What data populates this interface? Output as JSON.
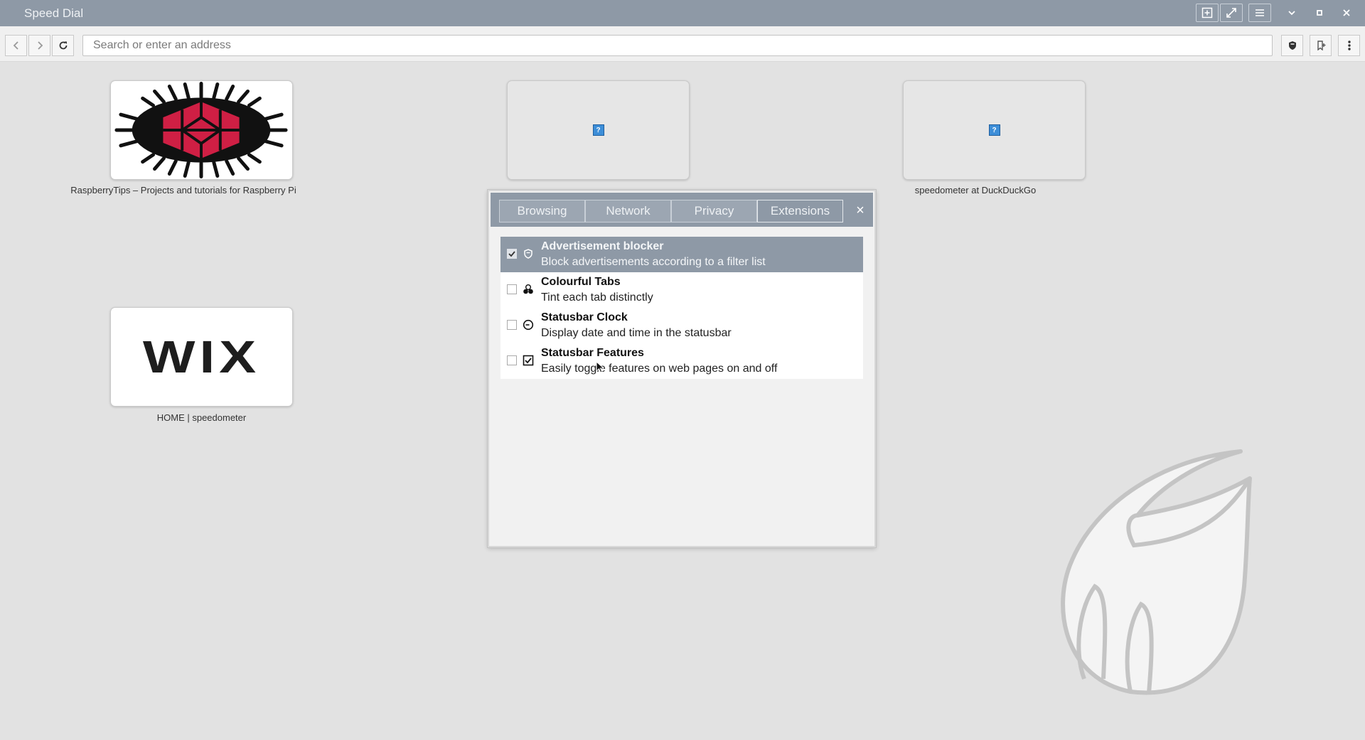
{
  "window": {
    "title": "Speed Dial"
  },
  "toolbar": {
    "address_placeholder": "Search or enter an address"
  },
  "speed_dial": {
    "tiles": [
      {
        "label": "RaspberryTips – Projects and tutorials for Raspberry Pi"
      },
      {
        "label": "speedometer at DuckDuckGo"
      },
      {
        "label": "HOME | speedometer"
      }
    ],
    "wix_logo_text": "WIX"
  },
  "dialog": {
    "tabs": [
      {
        "label": "Browsing"
      },
      {
        "label": "Network"
      },
      {
        "label": "Privacy"
      },
      {
        "label": "Extensions",
        "active": true
      }
    ],
    "close_glyph": "×",
    "extensions": [
      {
        "name": "Advertisement blocker",
        "description": "Block advertisements according to a filter list",
        "enabled": true,
        "selected": true,
        "icon": "shield-icon"
      },
      {
        "name": "Colourful Tabs",
        "description": "Tint each tab distinctly",
        "enabled": false,
        "selected": false,
        "icon": "colour-circles-icon"
      },
      {
        "name": "Statusbar Clock",
        "description": "Display date and time in the statusbar",
        "enabled": false,
        "selected": false,
        "icon": "clock-icon"
      },
      {
        "name": "Statusbar Features",
        "description": "Easily toggle features on web pages on and off",
        "enabled": false,
        "selected": false,
        "icon": "checkbox-icon"
      }
    ]
  },
  "colors": {
    "chrome": "#8e99a6",
    "background": "#e2e2e2",
    "raspberry": "#cf1f44"
  }
}
